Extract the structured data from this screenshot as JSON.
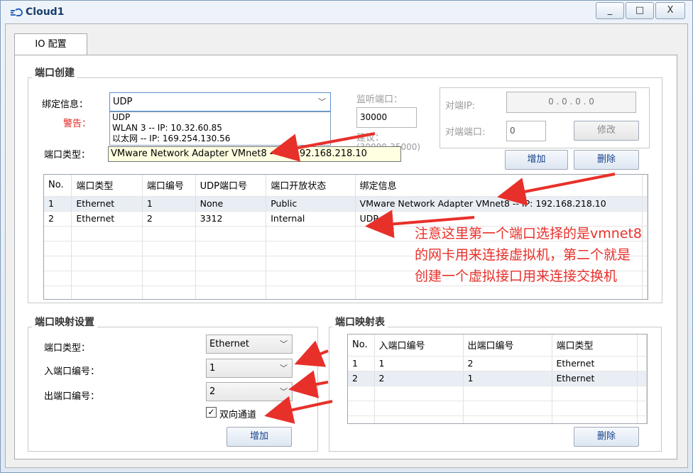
{
  "window": {
    "title": "Cloud1",
    "controls": {
      "minimize": "_",
      "maximize": "□",
      "close": "X"
    }
  },
  "tabs": [
    {
      "label": "IO 配置",
      "active": true
    }
  ],
  "port_create": {
    "group_title": "端口创建",
    "bind_label": "绑定信息：",
    "bind_value": "UDP",
    "warning_label": "警告：",
    "port_type_label": "端口类型：",
    "dropdown_options": [
      "UDP",
      "WLAN 3 -- IP: 10.32.60.85",
      "以太网 -- IP: 169.254.130.56"
    ],
    "tooltip": "VMware Network Adapter VMnet8 -- IP: 192.168.218.10",
    "listen_port_label": "监听端口：",
    "listen_port_value": "30000",
    "suggest_label": "建议：",
    "suggest_value": "(30000-35000)",
    "peer_ip_label": "对端IP:",
    "peer_ip_value": "0 . 0 . 0 . 0",
    "peer_port_label": "对端端口:",
    "peer_port_value": "0",
    "modify_button": "修改",
    "add_button": "增加",
    "delete_button": "删除"
  },
  "port_table": {
    "headers": [
      "No.",
      "端口类型",
      "端口编号",
      "UDP端口号",
      "端口开放状态",
      "绑定信息"
    ],
    "rows": [
      [
        "1",
        "Ethernet",
        "1",
        "None",
        "Public",
        "VMware Network Adapter VMnet8 -- IP: 192.168.218.10"
      ],
      [
        "2",
        "Ethernet",
        "2",
        "3312",
        "Internal",
        "UDP"
      ]
    ]
  },
  "mapping_settings": {
    "group_title": "端口映射设置",
    "port_type_label": "端口类型：",
    "port_type_value": "Ethernet",
    "in_port_label": "入端口编号：",
    "in_port_value": "1",
    "out_port_label": "出端口编号：",
    "out_port_value": "2",
    "bidirectional_label": "双向通道",
    "bidirectional_checked": true,
    "add_button": "增加"
  },
  "mapping_table": {
    "group_title": "端口映射表",
    "headers": [
      "No.",
      "入端口编号",
      "出端口编号",
      "端口类型"
    ],
    "rows": [
      [
        "1",
        "1",
        "2",
        "Ethernet"
      ],
      [
        "2",
        "2",
        "1",
        "Ethernet"
      ]
    ],
    "delete_button": "删除"
  },
  "annotation": {
    "lines": [
      "注意这里第一个端口选择的是vmnet8",
      "的网卡用来连接虚拟机，第二个就是",
      "创建一个虚拟接口用来连接交换机"
    ],
    "color": "#e8302a"
  }
}
